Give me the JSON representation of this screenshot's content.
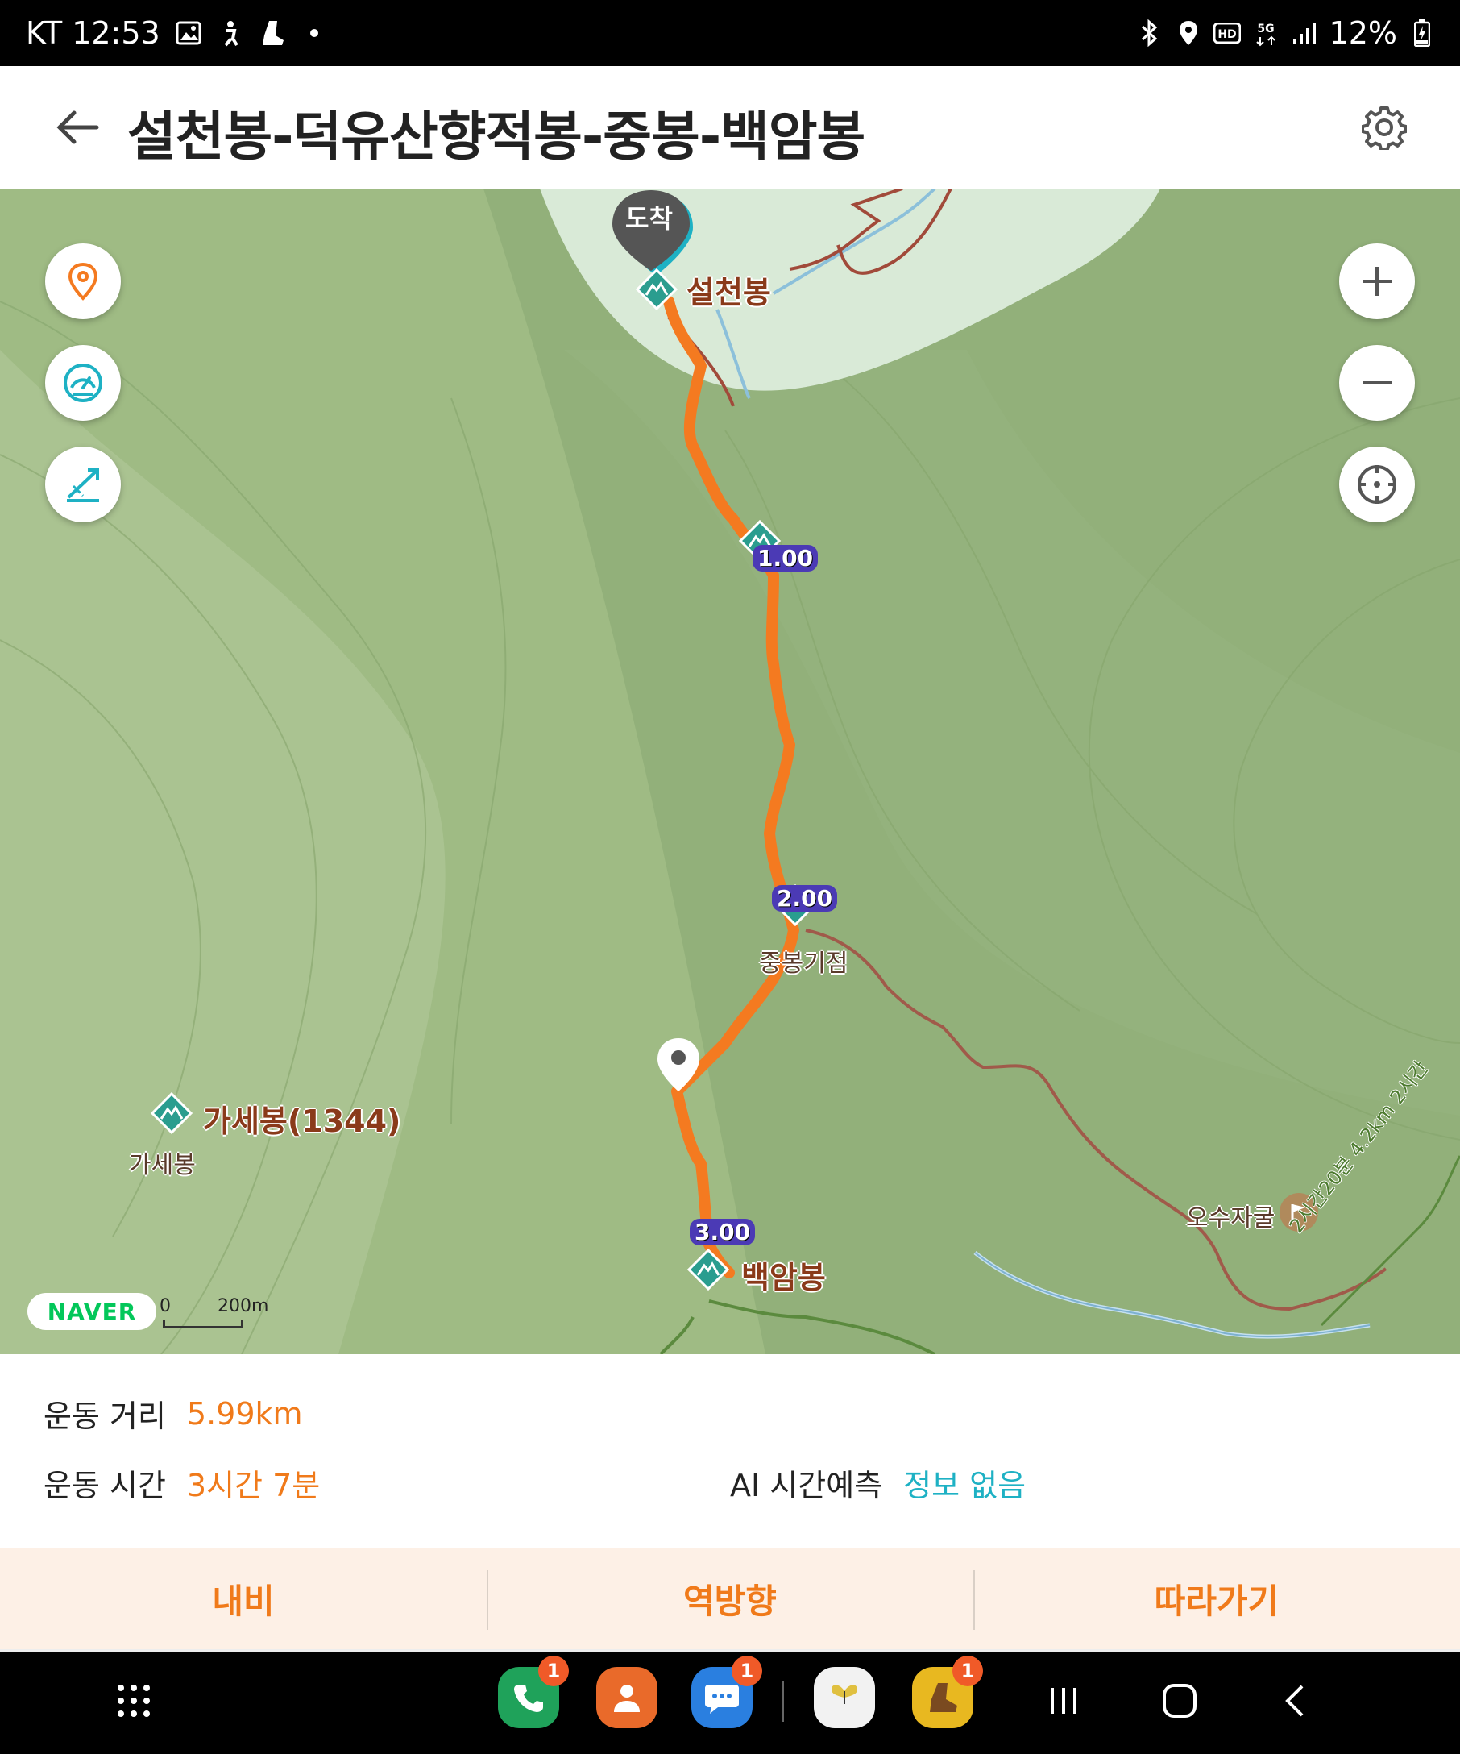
{
  "status_bar": {
    "carrier": "KT",
    "time": "12:53",
    "battery": "12%"
  },
  "header": {
    "title": "설천봉-덕유산향적봉-중봉-백암봉"
  },
  "map": {
    "arrival_label": "도착",
    "peaks": [
      {
        "name": "설천봉"
      },
      {
        "name": "백암봉"
      },
      {
        "name": "가세봉(1344)"
      }
    ],
    "small_labels": {
      "junction": "중봉기점",
      "gase": "가세봉",
      "osujagul": "오수자굴",
      "trail_info": "2시간20분 4.2km 2시간"
    },
    "km_markers": [
      "1.00",
      "2.00",
      "3.00"
    ],
    "scale": {
      "zero": "0",
      "length": "200m"
    },
    "logo": "NAVER",
    "colors": {
      "route": "#f47a20",
      "trail": "#a05a4a",
      "terrain": "#9fbb84",
      "accent_blue": "#1eb1c4"
    }
  },
  "info": {
    "distance_label": "운동 거리",
    "distance_value": "5.99km",
    "time_label": "운동 시간",
    "time_value": "3시간 7분",
    "ai_label": "AI 시간예측",
    "ai_value": "정보 없음"
  },
  "actions": {
    "navi": "내비",
    "reverse": "역방향",
    "follow": "따라가기"
  },
  "navbar": {
    "badges": {
      "phone": "1",
      "messages": "1",
      "tracker": "1"
    }
  }
}
